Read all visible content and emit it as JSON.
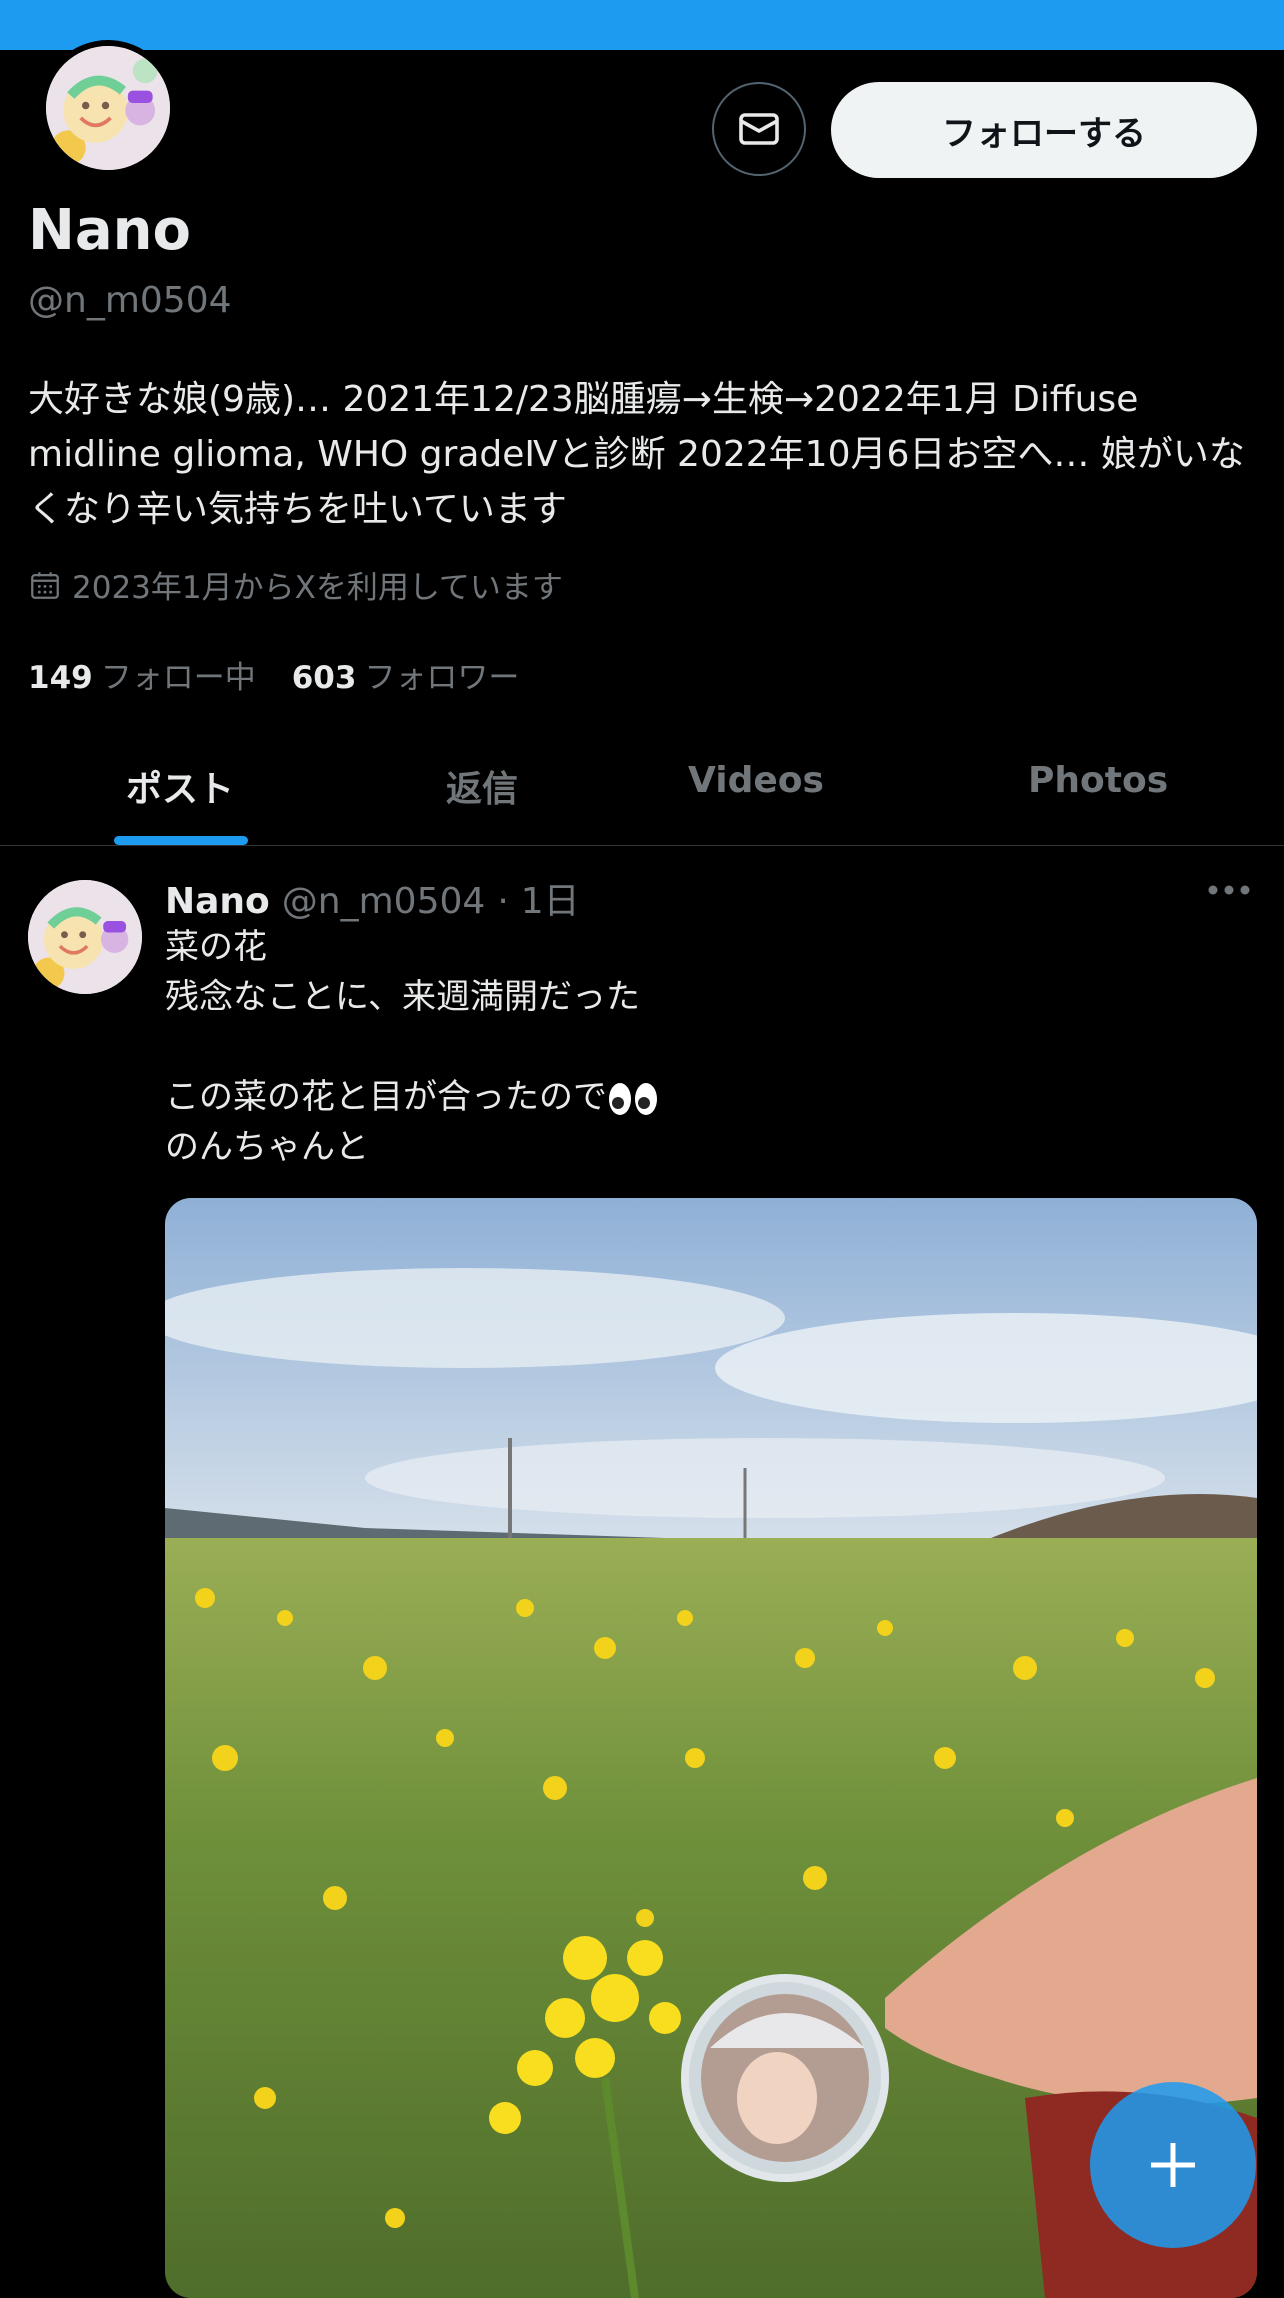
{
  "profile": {
    "name": "Nano",
    "handle": "@n_m0504",
    "bio": "大好きな娘(9歳)… 2021年12/23脳腫瘍→生検→2022年1月 Diffuse midline glioma, WHO gradeⅣと診断 2022年10月6日お空へ… 娘がいなくなり辛い気持ちを吐いています",
    "joined": "2023年1月からXを利用しています",
    "following_count": "149",
    "following_label": "フォロー中",
    "followers_count": "603",
    "followers_label": "フォロワー",
    "follow_button": "フォローする",
    "banner_color": "#1d9bf0"
  },
  "tabs": [
    {
      "label": "ポスト",
      "active": true
    },
    {
      "label": "返信",
      "active": false
    },
    {
      "label": "Videos",
      "active": false
    },
    {
      "label": "Photos",
      "active": false
    }
  ],
  "post": {
    "name": "Nano",
    "handle": "@n_m0504",
    "separator": "·",
    "time": "1日",
    "lines": [
      "菜の花",
      "残念なことに、来週満開だった",
      "",
      "この菜の花と目が合ったので",
      "のんちゃんと"
    ],
    "emoji": "eyes-emoji"
  },
  "icons": {
    "message": "mail-icon",
    "calendar": "calendar-icon",
    "more": "more-icon",
    "compose": "plus-icon"
  },
  "colors": {
    "accent": "#1d9bf0",
    "text": "#e7e9ea",
    "muted": "#71767b"
  }
}
